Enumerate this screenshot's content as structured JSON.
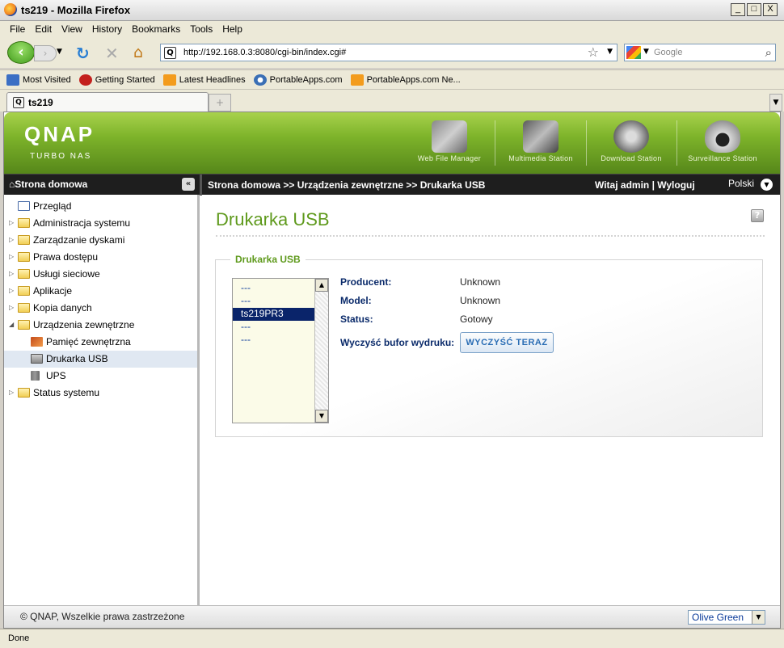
{
  "window": {
    "title": "ts219 - Mozilla Firefox",
    "controls": [
      "_",
      "□",
      "X"
    ]
  },
  "menubar": [
    "File",
    "Edit",
    "View",
    "History",
    "Bookmarks",
    "Tools",
    "Help"
  ],
  "navigation": {
    "url": "http://192.168.0.3:8080/cgi-bin/index.cgi#",
    "search_placeholder": "Google"
  },
  "bookmarks": [
    {
      "label": "Most Visited",
      "icon": "most-visited-icon"
    },
    {
      "label": "Getting Started",
      "icon": "getting-started-icon"
    },
    {
      "label": "Latest Headlines",
      "icon": "rss-icon"
    },
    {
      "label": "PortableApps.com",
      "icon": "portableapps-icon"
    },
    {
      "label": "PortableApps.com Ne...",
      "icon": "rss-icon"
    }
  ],
  "tabs": [
    {
      "label": "ts219"
    }
  ],
  "qnap": {
    "logo": "QNAP",
    "sublogo": "TURBO NAS",
    "apps": [
      {
        "label": "Web File Manager",
        "icon": "web-file-manager-icon"
      },
      {
        "label": "Multimedia Station",
        "icon": "multimedia-station-icon"
      },
      {
        "label": "Download Station",
        "icon": "download-station-icon"
      },
      {
        "label": "Surveillance Station",
        "icon": "surveillance-station-icon"
      }
    ]
  },
  "topbar": {
    "home": "Strona domowa",
    "collapse": "«",
    "breadcrumb": "Strona domowa >> Urządzenia zewnętrzne >> Drukarka USB",
    "welcome": "Witaj admin | Wyloguj",
    "language": "Polski"
  },
  "sidebar": {
    "items": [
      {
        "label": "Przegląd",
        "icon": "page"
      },
      {
        "label": "Administracja systemu",
        "icon": "folder"
      },
      {
        "label": "Zarządzanie dyskami",
        "icon": "folder"
      },
      {
        "label": "Prawa dostępu",
        "icon": "folder"
      },
      {
        "label": "Usługi sieciowe",
        "icon": "folder"
      },
      {
        "label": "Aplikacje",
        "icon": "folder"
      },
      {
        "label": "Kopia danych",
        "icon": "folder"
      },
      {
        "label": "Urządzenia zewnętrzne",
        "icon": "folder-open"
      },
      {
        "label": "Pamięć zewnętrzna",
        "icon": "external-storage"
      },
      {
        "label": "Drukarka USB",
        "icon": "printer",
        "selected": true
      },
      {
        "label": "UPS",
        "icon": "ups"
      },
      {
        "label": "Status systemu",
        "icon": "folder"
      }
    ]
  },
  "main": {
    "title": "Drukarka USB",
    "help": "?",
    "section": {
      "legend": "Drukarka USB",
      "printers": [
        "---",
        "---",
        "ts219PR3",
        "---",
        "---"
      ],
      "selected_printer": "ts219PR3",
      "fields": [
        {
          "key": "Producent:",
          "value": "Unknown"
        },
        {
          "key": "Model:",
          "value": "Unknown"
        },
        {
          "key": "Status:",
          "value": "Gotowy"
        }
      ],
      "clear_label": "Wyczyść bufor wydruku:",
      "clear_button": "WYCZYŚĆ TERAZ"
    }
  },
  "footer": {
    "copyright": "© QNAP, Wszelkie prawa zastrzeżone",
    "theme": "Olive Green"
  },
  "status": "Done"
}
